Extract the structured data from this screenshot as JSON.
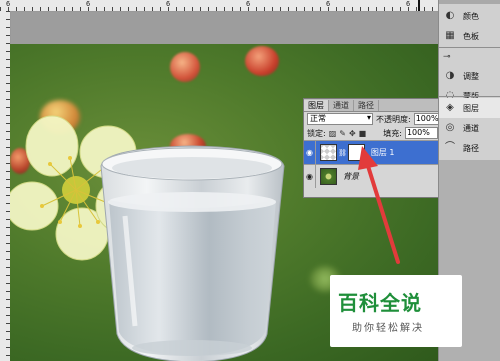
{
  "ruler": {
    "marks": [
      "6",
      "6",
      "6",
      "6",
      "6",
      "6"
    ]
  },
  "layers_panel": {
    "tabs": [
      "图层",
      "通道",
      "路径"
    ],
    "menu_glyph": "▸▸ ≡",
    "blend_mode": "正常",
    "opacity_label": "不透明度:",
    "opacity_value": "100%",
    "lock_label": "锁定:",
    "fill_label": "填充:",
    "fill_value": "100%",
    "layers": [
      {
        "name": "图层 1",
        "selected": true
      },
      {
        "name": "背景",
        "selected": false
      }
    ]
  },
  "dock": {
    "items": [
      {
        "label": "颜色",
        "icon": "palette-icon"
      },
      {
        "label": "色板",
        "icon": "swatches-icon"
      },
      {
        "label": "调整",
        "icon": "adjust-icon"
      },
      {
        "label": "蒙版",
        "icon": "mask-icon"
      },
      {
        "label": "图层",
        "icon": "layers-icon"
      },
      {
        "label": "通道",
        "icon": "channels-icon"
      },
      {
        "label": "路径",
        "icon": "paths-icon"
      }
    ]
  },
  "watermark": {
    "main": "百科全说",
    "sub": "助你轻松解决"
  },
  "colors": {
    "selection": "#3d6fd0",
    "arrow": "#e23b3b",
    "brand_green": "#1f8f3a"
  }
}
